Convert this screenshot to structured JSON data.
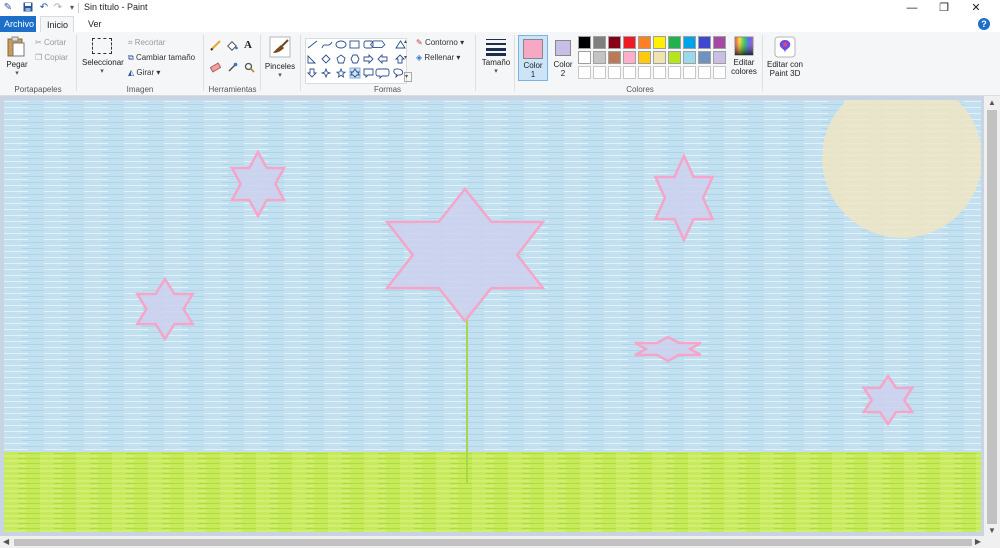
{
  "window": {
    "title": "Sin título - Paint",
    "minimize": "—",
    "restore": "❐",
    "close": "✕"
  },
  "tabs": {
    "file": "Archivo",
    "home": "Inicio",
    "view": "Ver",
    "help": "?"
  },
  "clipboard": {
    "paste": "Pegar",
    "cut": "Cortar",
    "copy": "Copiar",
    "label": "Portapapeles"
  },
  "image": {
    "select": "Seleccionar",
    "crop": "Recortar",
    "resize": "Cambiar tamaño",
    "rotate": "Girar",
    "label": "Imagen"
  },
  "tools": {
    "label": "Herramientas"
  },
  "brushes": {
    "label": "Pinceles"
  },
  "shapes": {
    "outline": "Contorno",
    "fill": "Rellenar",
    "label": "Formas"
  },
  "size": {
    "label": "Tamaño"
  },
  "color1": {
    "label": "Color",
    "number": "1",
    "value": "#f7a8c4"
  },
  "color2": {
    "label": "Color",
    "number": "2",
    "value": "#c8bfe7"
  },
  "colors": {
    "label": "Colores",
    "edit": "Editar",
    "edit2": "colores",
    "row1": [
      "#000000",
      "#7f7f7f",
      "#880015",
      "#ed1c24",
      "#ff7f27",
      "#fff200",
      "#22b14c",
      "#00a2e8",
      "#3f48cc",
      "#a349a4"
    ],
    "row2": [
      "#ffffff",
      "#c3c3c3",
      "#b97a57",
      "#ffaec9",
      "#ffc90e",
      "#efe4b0",
      "#b5e61d",
      "#99d9ea",
      "#7092be",
      "#c8bfe7"
    ]
  },
  "paint3d": {
    "line1": "Editar con",
    "line2": "Paint 3D"
  },
  "drawing": {
    "sky": "#c2e0f0",
    "grass": "#c6ea5a",
    "sun": "#f2e6c2",
    "star_outline": "#f5a5c8",
    "star_fill": "#cdd0ee",
    "stem": "#a8d848"
  }
}
